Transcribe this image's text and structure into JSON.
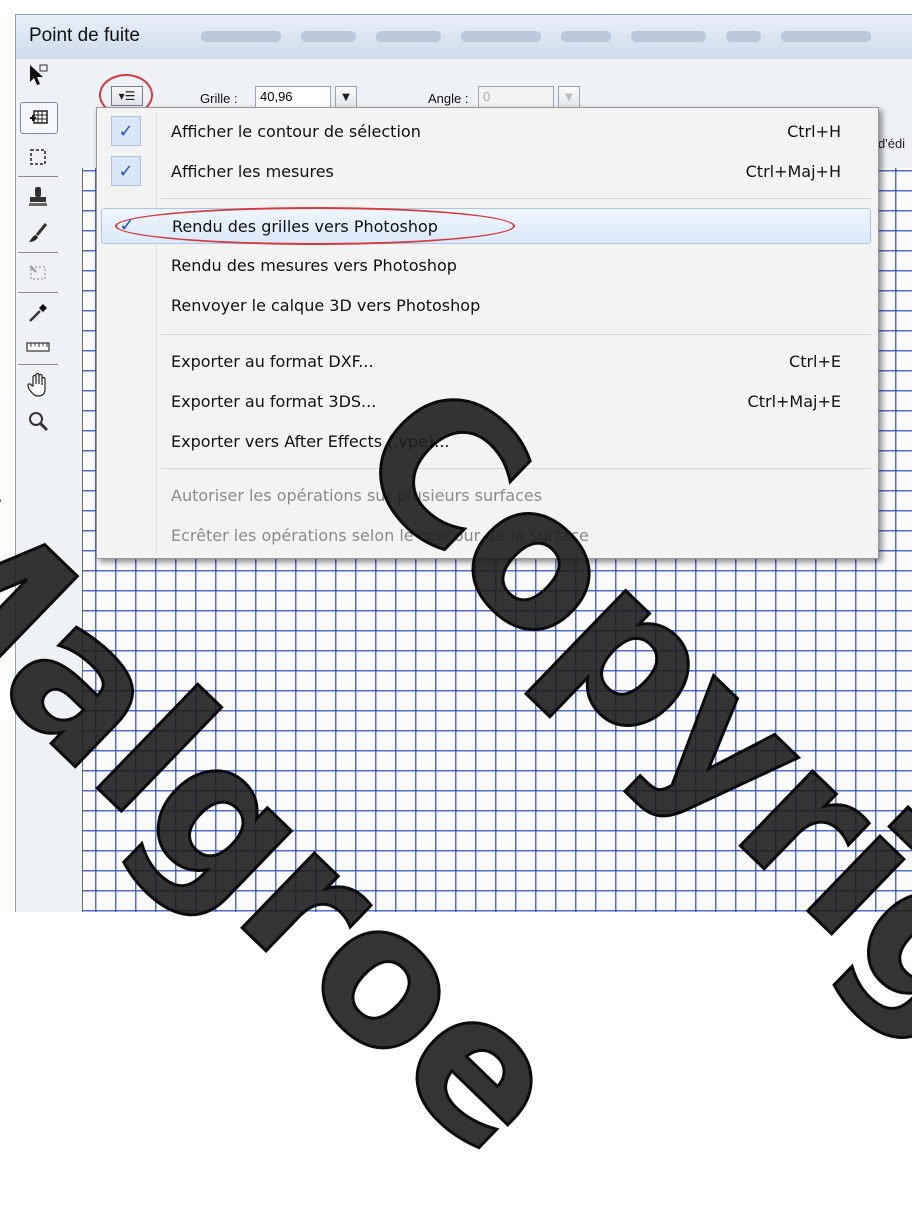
{
  "window": {
    "title": "Point de fuite"
  },
  "toolbar": {
    "grid_label": "Grille :",
    "grid_value": "40,96",
    "angle_label": "Angle :",
    "angle_value": "0",
    "clipped_label": "d'édi"
  },
  "tools": [
    {
      "name": "edit-plane-tool-icon"
    },
    {
      "name": "create-plane-tool-icon"
    },
    {
      "name": "marquee-tool-icon"
    },
    {
      "name": "stamp-tool-icon"
    },
    {
      "name": "brush-tool-icon"
    },
    {
      "name": "transform-tool-icon"
    },
    {
      "name": "eyedropper-tool-icon"
    },
    {
      "name": "measure-tool-icon"
    },
    {
      "name": "hand-tool-icon"
    },
    {
      "name": "zoom-tool-icon"
    }
  ],
  "menu": {
    "items": [
      {
        "label": "Afficher le contour de sélection",
        "shortcut": "Ctrl+H",
        "checked": true,
        "disabled": false
      },
      {
        "label": "Afficher les mesures",
        "shortcut": "Ctrl+Maj+H",
        "checked": true,
        "disabled": false
      },
      {
        "label": "Rendu des grilles vers Photoshop",
        "shortcut": "",
        "checked": true,
        "disabled": false,
        "highlighted": true
      },
      {
        "label": "Rendu des mesures vers Photoshop",
        "shortcut": "",
        "checked": false,
        "disabled": false
      },
      {
        "label": "Renvoyer le calque 3D vers Photoshop",
        "shortcut": "",
        "checked": false,
        "disabled": false
      },
      {
        "label": "Exporter au format DXF...",
        "shortcut": "Ctrl+E",
        "checked": false,
        "disabled": false
      },
      {
        "label": "Exporter au format 3DS...",
        "shortcut": "Ctrl+Maj+E",
        "checked": false,
        "disabled": false
      },
      {
        "label": "Exporter vers After Effects (.vpe)...",
        "shortcut": "",
        "checked": false,
        "disabled": false
      },
      {
        "label": "Autoriser les opérations sur plusieurs surfaces",
        "shortcut": "",
        "checked": false,
        "disabled": true
      },
      {
        "label": "Ecrêter les opérations selon le contour de la surface",
        "shortcut": "",
        "checked": false,
        "disabled": true
      }
    ]
  },
  "watermark": {
    "line1": "Malgroe",
    "line2": "Copyright"
  },
  "colors": {
    "grid": "#3755be",
    "annotation": "#d6393e",
    "check": "#2552c2"
  }
}
